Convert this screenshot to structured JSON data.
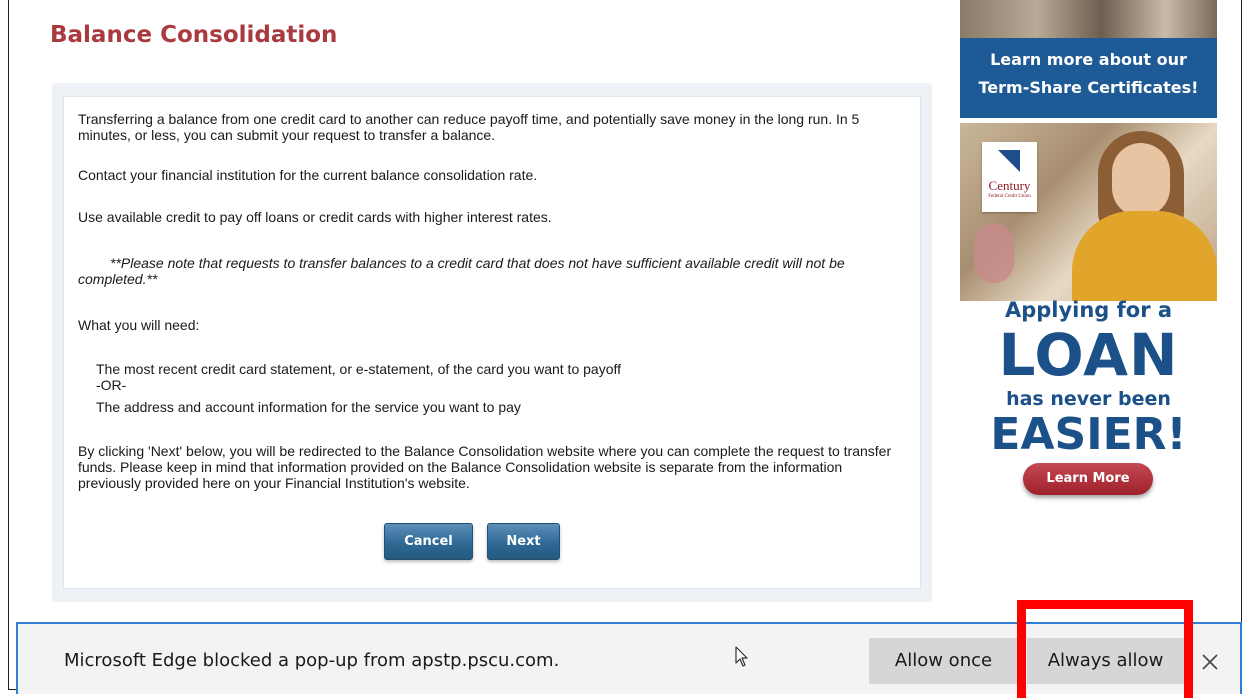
{
  "page": {
    "title": "Balance Consolidation",
    "paragraphs": {
      "intro": "Transferring a balance from one credit card to another can reduce payoff time, and potentially save money in the long run. In 5 minutes, or less, you can submit your request to transfer a balance.",
      "contact": "Contact your financial institution for the current balance consolidation rate.",
      "use_credit": "Use available credit to pay off loans or credit cards with higher interest rates.",
      "note": "**Please note that requests to transfer balances to a credit card that does not have sufficient available credit will not be completed.**",
      "need_heading": "What you will need:",
      "need_item_1": "The most recent credit card statement, or e-statement, of the card you want to payoff",
      "need_or": "-OR-",
      "need_item_2": "The address and account information for the service you want to pay",
      "redirect_notice": "By clicking 'Next' below, you will be redirected to the Balance Consolidation website where you can complete the request to transfer funds. Please keep in mind that information provided on the Balance Consolidation website is separate from the information previously provided here on your Financial Institution's website."
    },
    "buttons": {
      "cancel": "Cancel",
      "next": "Next"
    }
  },
  "ads": {
    "term_share": {
      "line1": "Learn more about our",
      "line2": "Term-Share Certificates!"
    },
    "loan": {
      "logo_name": "Century",
      "logo_sub": "Federal Credit Union",
      "line1": "Applying for a",
      "line2": "LOAN",
      "line3": "has never been",
      "line4": "EASIER!",
      "button": "Learn More"
    }
  },
  "popup_bar": {
    "message": "Microsoft Edge blocked a pop-up from apstp.pscu.com.",
    "allow_once": "Allow once",
    "always_allow": "Always allow"
  },
  "colors": {
    "title": "#a93a3f",
    "button_blue": "#2f6a96",
    "ad_blue": "#1b5088",
    "ad_red": "#9e1f2b",
    "bar_border": "#2f7fd4",
    "highlight": "#ff0000"
  },
  "icons": {
    "close": "close-icon",
    "cursor": "mouse-cursor-icon"
  }
}
